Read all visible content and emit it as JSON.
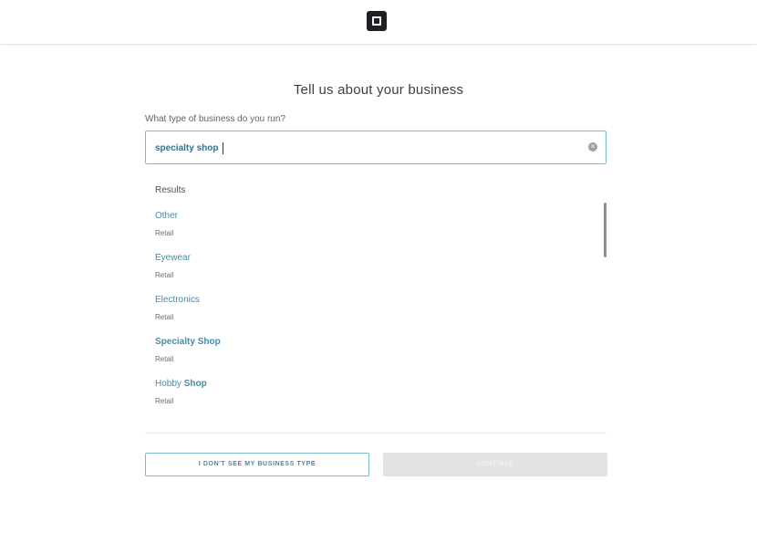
{
  "header": {
    "logo_icon": "square-logo-icon"
  },
  "page": {
    "title": "Tell us about your business",
    "question": "What type of business do you run?"
  },
  "search": {
    "value": "specialty shop",
    "clear_icon": "clear-circle-icon"
  },
  "results": {
    "heading": "Results",
    "items": [
      {
        "name": "Other",
        "category": "Retail"
      },
      {
        "name": "Eyewear",
        "category": "Retail"
      },
      {
        "name": "Electronics",
        "category": "Retail"
      },
      {
        "name": "Specialty Shop",
        "category": "Retail"
      },
      {
        "name_prefix": "Hobby ",
        "name_match": "Shop",
        "category": "Retail"
      }
    ]
  },
  "buttons": {
    "not_listed": "I DON'T SEE MY BUSINESS TYPE",
    "continue": "CONTINUE"
  },
  "colors": {
    "accent": "#4a8aa6",
    "border_accent": "#7ab8d0",
    "disabled_bg": "#e2e3e4"
  }
}
